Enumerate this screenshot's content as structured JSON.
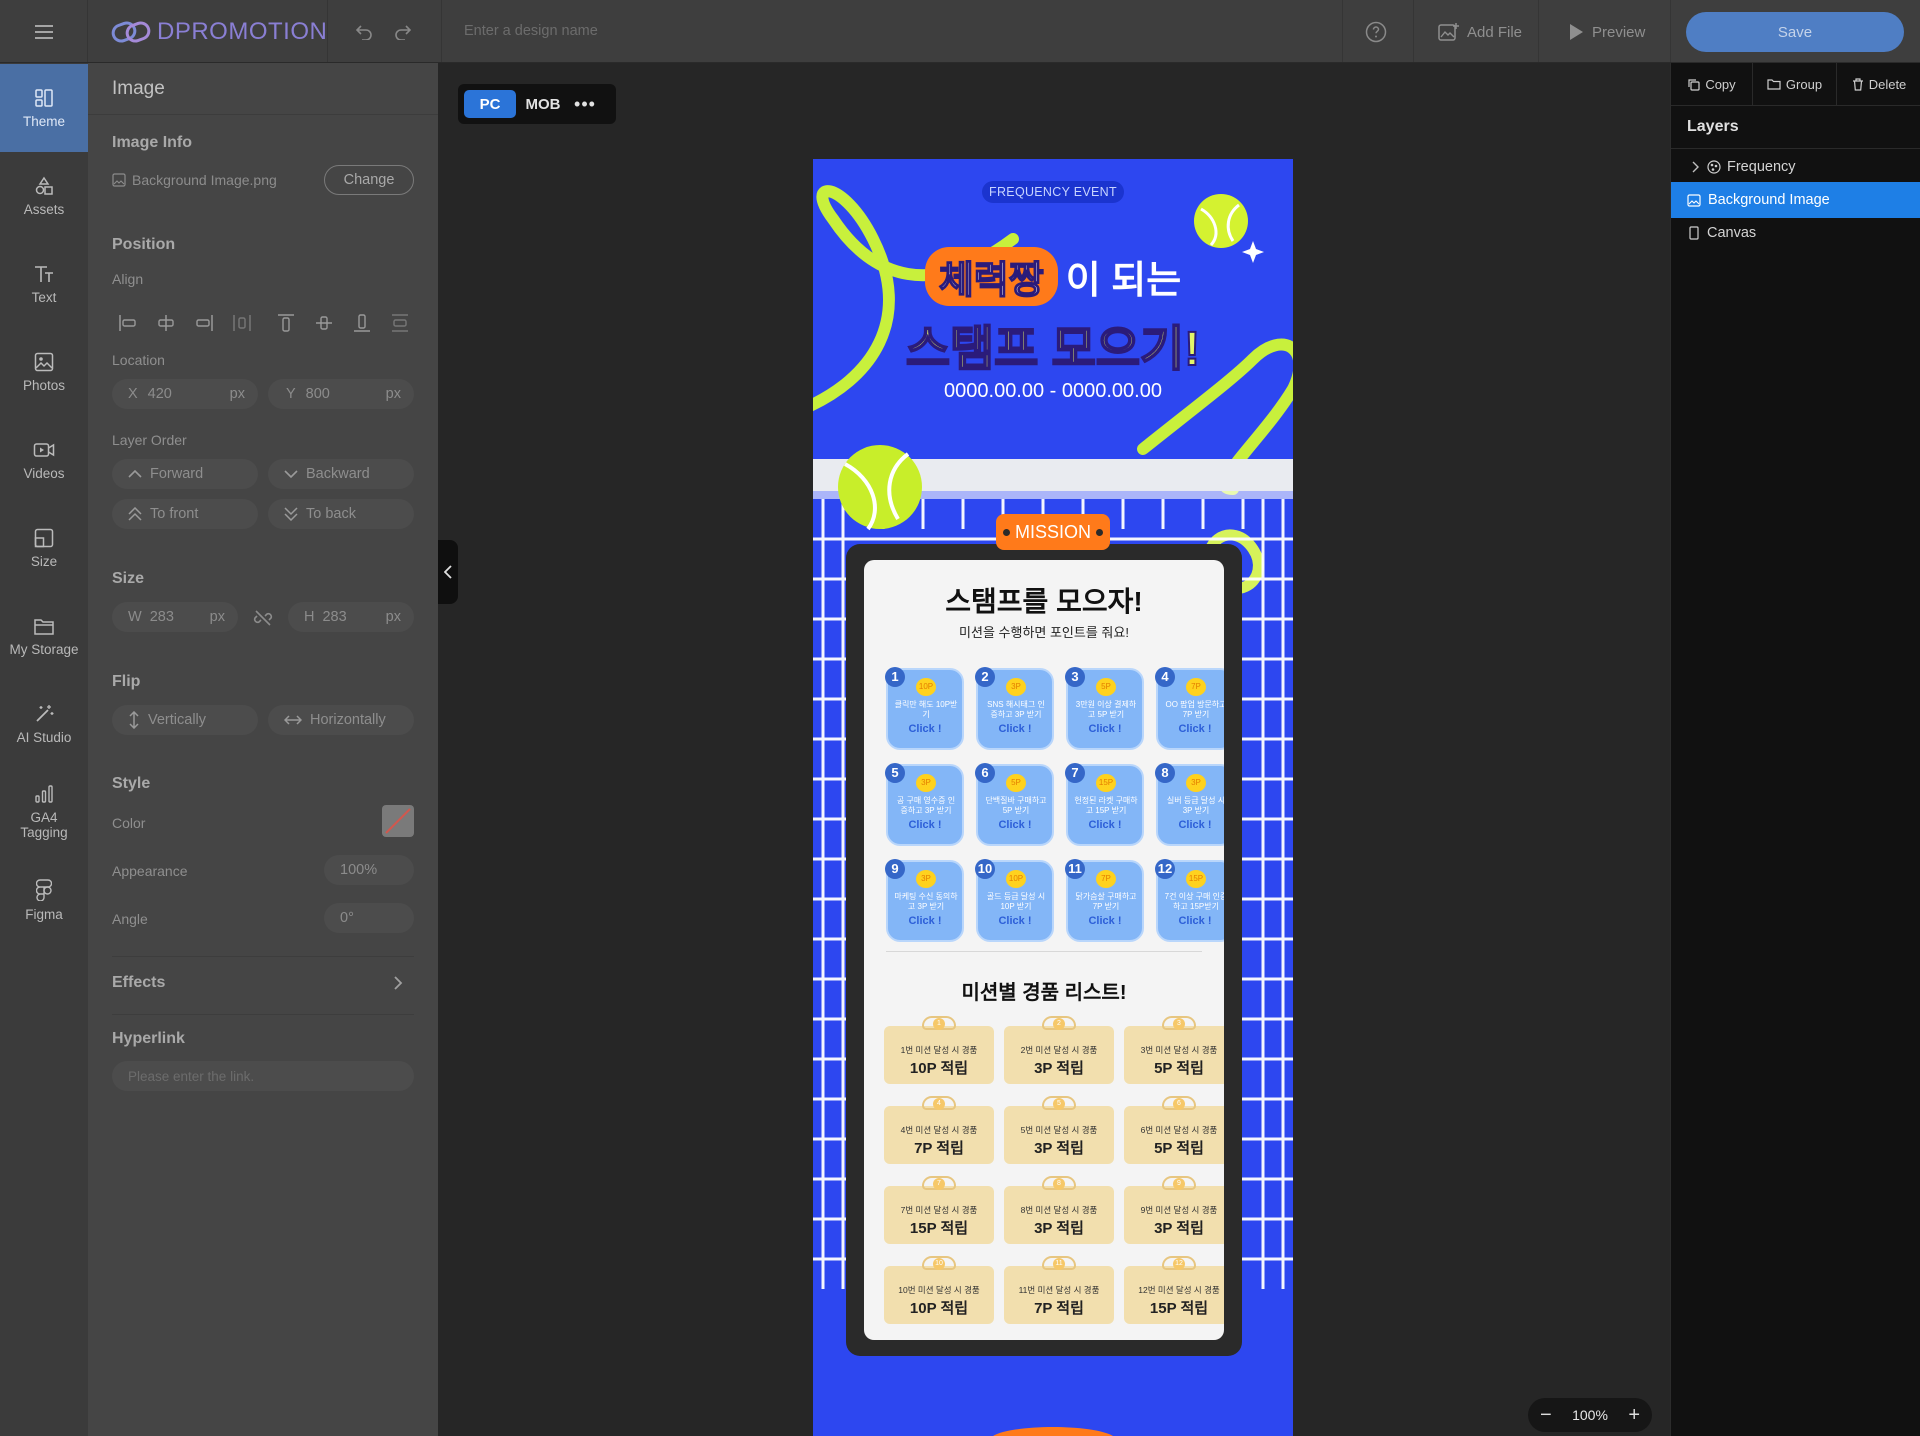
{
  "app": {
    "brand": "DPROMOTION",
    "design_name_placeholder": "Enter a design name",
    "add_file": "Add File",
    "preview": "Preview",
    "save": "Save"
  },
  "nav": [
    {
      "label": "Theme",
      "icon": "theme-icon"
    },
    {
      "label": "Assets",
      "icon": "assets-icon"
    },
    {
      "label": "Text",
      "icon": "text-icon"
    },
    {
      "label": "Photos",
      "icon": "photos-icon"
    },
    {
      "label": "Videos",
      "icon": "videos-icon"
    },
    {
      "label": "Size",
      "icon": "size-icon"
    },
    {
      "label": "My Storage",
      "icon": "folder-icon"
    },
    {
      "label": "AI Studio",
      "icon": "magic-wand-icon"
    },
    {
      "label": "GA4 Tagging",
      "icon": "bar-chart-icon"
    },
    {
      "label": "Figma",
      "icon": "figma-icon"
    }
  ],
  "props": {
    "title": "Image",
    "image_info": "Image Info",
    "file_name": "Background Image.png",
    "change": "Change",
    "position": "Position",
    "align": "Align",
    "location": "Location",
    "x_label": "X",
    "x_value": "420",
    "y_label": "Y",
    "y_value": "800",
    "unit": "px",
    "layer_order": "Layer Order",
    "forward": "Forward",
    "backward": "Backward",
    "to_front": "To front",
    "to_back": "To back",
    "size": "Size",
    "w_label": "W",
    "w_value": "283",
    "h_label": "H",
    "h_value": "283",
    "flip": "Flip",
    "vertically": "Vertically",
    "horizontally": "Horizontally",
    "style": "Style",
    "color": "Color",
    "appearance": "Appearance",
    "appearance_value": "100%",
    "angle": "Angle",
    "angle_value": "0°",
    "effects": "Effects",
    "hyperlink": "Hyperlink",
    "link_placeholder": "Please enter the link."
  },
  "canvas": {
    "pc": "PC",
    "mob": "MOB",
    "zoom": "100%"
  },
  "poster": {
    "badge": "FREQUENCY EVENT",
    "headline_highlight": "체력짱",
    "headline_rest": "이 되는",
    "headline2": "스탬프 모으기!",
    "date": "0000.00.00 - 0000.00.00",
    "mission_tag": "MISSION",
    "card_title": "스탬프를 모으자!",
    "card_sub": "미션을 수행하면 포인트를 줘요!",
    "click": "Click !",
    "missions": [
      {
        "n": "1",
        "pt": "10P",
        "desc": "클릭만 해도 10P받기"
      },
      {
        "n": "2",
        "pt": "3P",
        "desc": "SNS 해시태그 인증하고 3P 받기"
      },
      {
        "n": "3",
        "pt": "5P",
        "desc": "3만원 이상 결제하고 5P 받기"
      },
      {
        "n": "4",
        "pt": "7P",
        "desc": "OO 팝업 방문하고 7P 받기"
      },
      {
        "n": "5",
        "pt": "3P",
        "desc": "공 구매 영수증 인증하고 3P 받기"
      },
      {
        "n": "6",
        "pt": "5P",
        "desc": "단백질바 구매하고 5P 받기"
      },
      {
        "n": "7",
        "pt": "15P",
        "desc": "헌정된 라켓 구매하고 15P 받기"
      },
      {
        "n": "8",
        "pt": "3P",
        "desc": "실버 등급 달성 시 3P 받기"
      },
      {
        "n": "9",
        "pt": "3P",
        "desc": "마케팅 수신 동의하고 3P 받기"
      },
      {
        "n": "10",
        "pt": "10P",
        "desc": "골드 등급 달성 시 10P 받기"
      },
      {
        "n": "11",
        "pt": "7P",
        "desc": "닭가슴살 구매하고 7P 받기"
      },
      {
        "n": "12",
        "pt": "15P",
        "desc": "7건 이상 구매 인증하고 15P받기"
      }
    ],
    "prize_title": "미션별 경품 리스트!",
    "prizes": [
      {
        "n": "1",
        "title": "1번 미션 달성 시 경품",
        "pts": "10P 적립"
      },
      {
        "n": "2",
        "title": "2번 미션 달성 시 경품",
        "pts": "3P 적립"
      },
      {
        "n": "3",
        "title": "3번 미션 달성 시 경품",
        "pts": "5P 적립"
      },
      {
        "n": "4",
        "title": "4번 미션 달성 시 경품",
        "pts": "7P 적립"
      },
      {
        "n": "5",
        "title": "5번 미션 달성 시 경품",
        "pts": "3P 적립"
      },
      {
        "n": "6",
        "title": "6번 미션 달성 시 경품",
        "pts": "5P 적립"
      },
      {
        "n": "7",
        "title": "7번 미션 달성 시 경품",
        "pts": "15P 적립"
      },
      {
        "n": "8",
        "title": "8번 미션 달성 시 경품",
        "pts": "3P 적립"
      },
      {
        "n": "9",
        "title": "9번 미션 달성 시 경품",
        "pts": "3P 적립"
      },
      {
        "n": "10",
        "title": "10번 미션 달성 시 경품",
        "pts": "10P 적립"
      },
      {
        "n": "11",
        "title": "11번 미션 달성 시 경품",
        "pts": "7P 적립"
      },
      {
        "n": "12",
        "title": "12번 미션 달성 시 경품",
        "pts": "15P 적립"
      }
    ]
  },
  "right": {
    "copy": "Copy",
    "group": "Group",
    "delete": "Delete",
    "layers_title": "Layers",
    "layers": [
      {
        "label": "Frequency",
        "icon": "frequency-icon",
        "selected": false
      },
      {
        "label": "Background Image",
        "icon": "image-icon",
        "selected": true
      },
      {
        "label": "Canvas",
        "icon": "canvas-icon",
        "selected": false
      }
    ]
  },
  "colors": {
    "accent": "#4f7ec4",
    "poster_blue": "#2d47f0",
    "lime": "#c8f03c",
    "orange": "#ff7a1a",
    "selected_layer": "#1e7fe6"
  }
}
